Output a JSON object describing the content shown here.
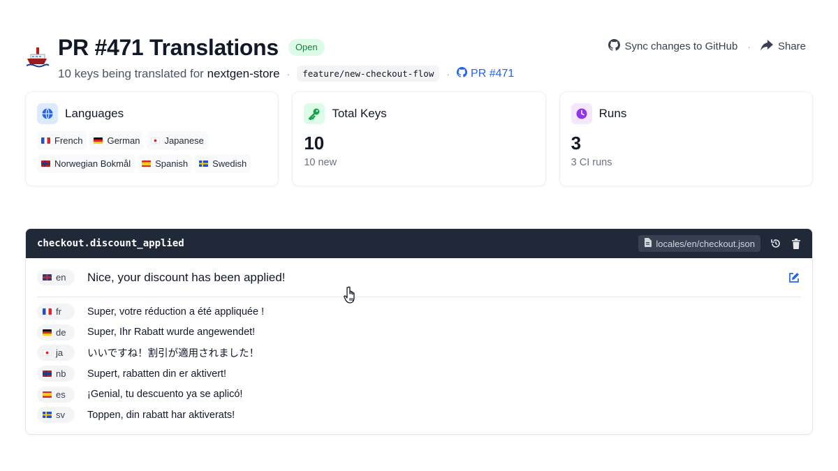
{
  "header": {
    "title": "PR #471 Translations",
    "status_badge": "Open",
    "subtitle_prefix": "10 keys being translated for",
    "repo": "nextgen-store",
    "branch": "feature/new-checkout-flow",
    "pr_link": "PR #471",
    "sync_label": "Sync changes to GitHub",
    "share_label": "Share",
    "separator": "·"
  },
  "cards": {
    "languages": {
      "title": "Languages",
      "items": [
        "French",
        "German",
        "Japanese",
        "Norwegian Bokmål",
        "Spanish",
        "Swedish"
      ]
    },
    "total_keys": {
      "title": "Total Keys",
      "value": "10",
      "detail": "10 new"
    },
    "runs": {
      "title": "Runs",
      "value": "3",
      "detail": "3 CI runs"
    }
  },
  "key_panel": {
    "key": "checkout.discount_applied",
    "file": "locales/en/checkout.json",
    "source": {
      "lang": "en",
      "text": "Nice, your discount has been applied!"
    },
    "translations": [
      {
        "lang": "fr",
        "text": "Super, votre réduction a été appliquée !"
      },
      {
        "lang": "de",
        "text": "Super, Ihr Rabatt wurde angewendet!"
      },
      {
        "lang": "ja",
        "text": "いいですね！割引が適用されました！"
      },
      {
        "lang": "nb",
        "text": "Supert, rabatten din er aktivert!"
      },
      {
        "lang": "es",
        "text": "¡Genial, tu descuento ya se aplicó!"
      },
      {
        "lang": "sv",
        "text": "Toppen, din rabatt har aktiverats!"
      }
    ]
  },
  "colors": {
    "accent": "#2563eb",
    "open_badge_bg": "#dcfce7",
    "open_badge_text": "#15803d",
    "key_bar_bg": "#1f2937",
    "languages_icon_bg": "#dbeafe",
    "keys_icon_bg": "#dcfce7",
    "runs_icon_bg": "#f3e8ff"
  },
  "icons": {
    "logo": "ship-icon",
    "sync": "github-icon",
    "share": "share-arrow-icon",
    "languages": "globe-icon",
    "keys": "key-icon",
    "runs": "clock-icon",
    "file": "file-icon",
    "history": "history-icon",
    "delete": "trash-icon",
    "edit": "edit-icon",
    "cursor": "hand-pointer-icon"
  }
}
